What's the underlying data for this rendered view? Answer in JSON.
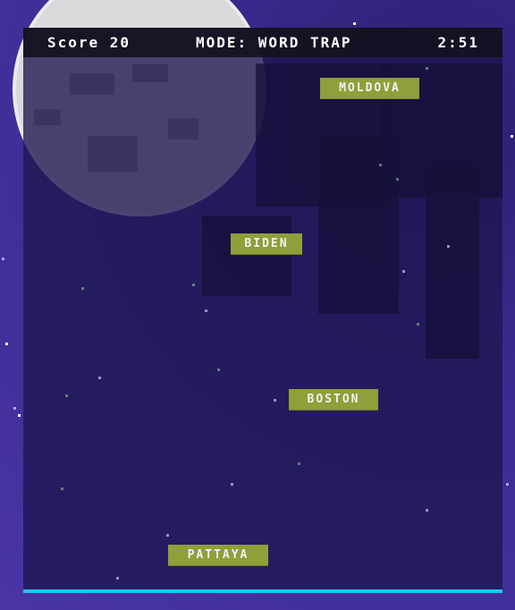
{
  "hud": {
    "score": "Score 20",
    "mode": "MODE: WORD TRAP",
    "timer": "2:51"
  },
  "words": [
    "MOLDOVA",
    "BIDEN",
    "BOSTON",
    "PATTAYA"
  ],
  "colors": {
    "word_background": "#8f9f3a",
    "floor_line": "#1ec8ee",
    "hud_background": "#121220",
    "sky": "#3b2a8f"
  }
}
